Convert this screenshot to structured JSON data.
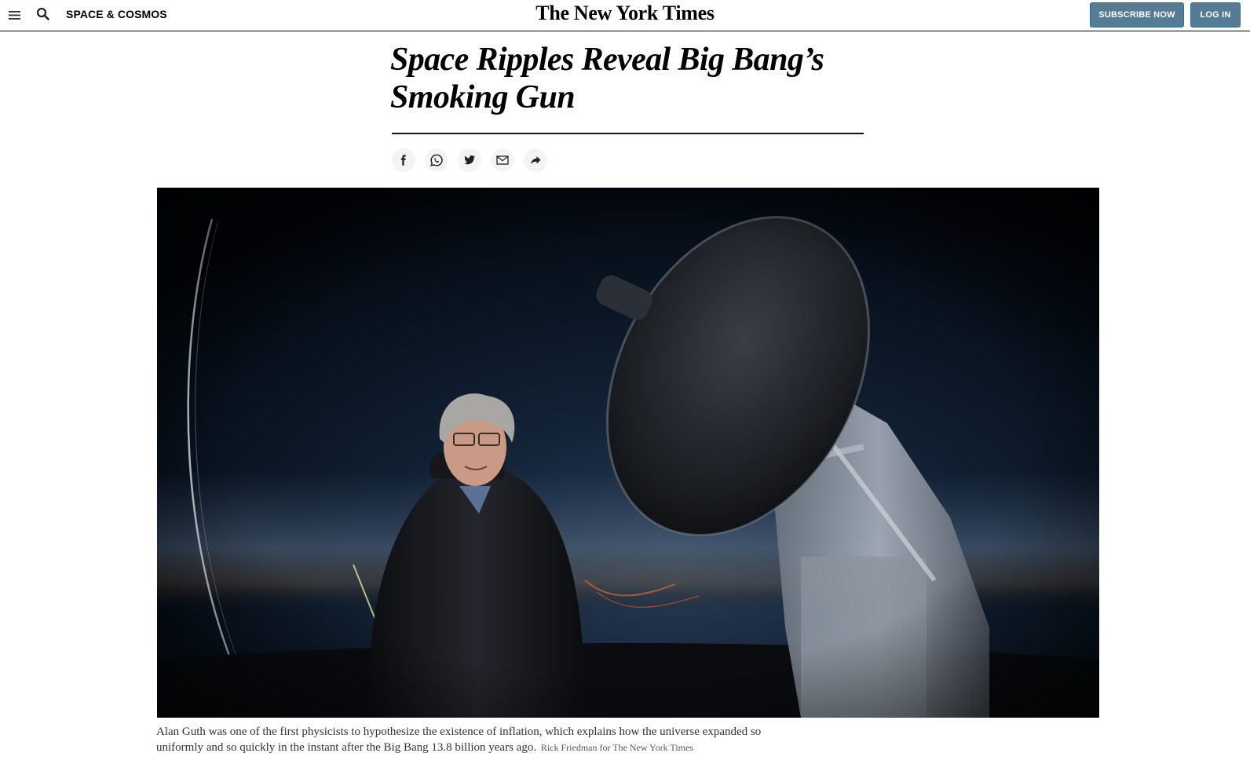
{
  "topbar": {
    "section": "SPACE & COSMOS",
    "masthead": "The New York Times",
    "subscribe_label": "SUBSCRIBE NOW",
    "login_label": "LOG IN",
    "icons": [
      "menu-icon",
      "search-icon"
    ]
  },
  "article": {
    "headline_line1": "Space Ripples Reveal Big Bang’s",
    "headline_line2": "Smoking Gun"
  },
  "share": {
    "icons": [
      "facebook-icon",
      "whatsapp-icon",
      "twitter-icon",
      "email-icon",
      "share-icon"
    ]
  },
  "photo": {
    "caption": "Alan Guth was one of the first physicists to hypothesize the existence of inflation, which explains how the universe expanded so uniformly and so quickly in the instant after the Big Bang 13.8 billion years ago.",
    "credit": "Rick Friedman for The New York Times"
  },
  "colors": {
    "button_blue": "#567b95",
    "text": "#121212",
    "share_bg": "#f4f4f4"
  }
}
